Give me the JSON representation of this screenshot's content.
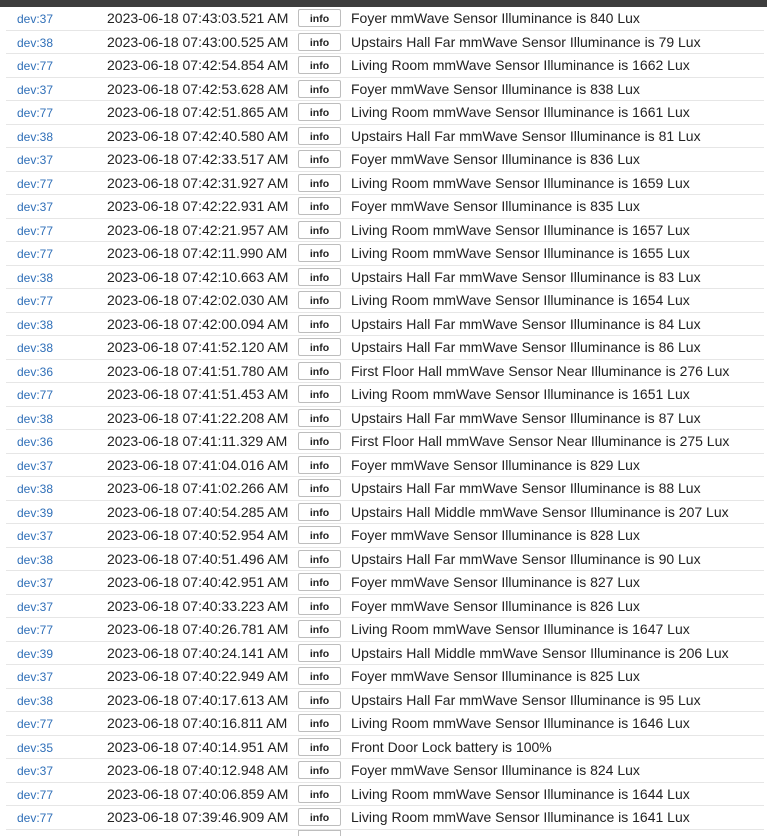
{
  "log": {
    "entries": [
      {
        "device": "dev:37",
        "timestamp": "2023-06-18 07:43:03.521 AM",
        "level": "info",
        "message": "Foyer mmWave Sensor Illuminance is 840 Lux"
      },
      {
        "device": "dev:38",
        "timestamp": "2023-06-18 07:43:00.525 AM",
        "level": "info",
        "message": "Upstairs Hall Far mmWave Sensor Illuminance is 79 Lux"
      },
      {
        "device": "dev:77",
        "timestamp": "2023-06-18 07:42:54.854 AM",
        "level": "info",
        "message": "Living Room mmWave Sensor Illuminance is 1662 Lux"
      },
      {
        "device": "dev:37",
        "timestamp": "2023-06-18 07:42:53.628 AM",
        "level": "info",
        "message": "Foyer mmWave Sensor Illuminance is 838 Lux"
      },
      {
        "device": "dev:77",
        "timestamp": "2023-06-18 07:42:51.865 AM",
        "level": "info",
        "message": "Living Room mmWave Sensor Illuminance is 1661 Lux"
      },
      {
        "device": "dev:38",
        "timestamp": "2023-06-18 07:42:40.580 AM",
        "level": "info",
        "message": "Upstairs Hall Far mmWave Sensor Illuminance is 81 Lux"
      },
      {
        "device": "dev:37",
        "timestamp": "2023-06-18 07:42:33.517 AM",
        "level": "info",
        "message": "Foyer mmWave Sensor Illuminance is 836 Lux"
      },
      {
        "device": "dev:77",
        "timestamp": "2023-06-18 07:42:31.927 AM",
        "level": "info",
        "message": "Living Room mmWave Sensor Illuminance is 1659 Lux"
      },
      {
        "device": "dev:37",
        "timestamp": "2023-06-18 07:42:22.931 AM",
        "level": "info",
        "message": "Foyer mmWave Sensor Illuminance is 835 Lux"
      },
      {
        "device": "dev:77",
        "timestamp": "2023-06-18 07:42:21.957 AM",
        "level": "info",
        "message": "Living Room mmWave Sensor Illuminance is 1657 Lux"
      },
      {
        "device": "dev:77",
        "timestamp": "2023-06-18 07:42:11.990 AM",
        "level": "info",
        "message": "Living Room mmWave Sensor Illuminance is 1655 Lux"
      },
      {
        "device": "dev:38",
        "timestamp": "2023-06-18 07:42:10.663 AM",
        "level": "info",
        "message": "Upstairs Hall Far mmWave Sensor Illuminance is 83 Lux"
      },
      {
        "device": "dev:77",
        "timestamp": "2023-06-18 07:42:02.030 AM",
        "level": "info",
        "message": "Living Room mmWave Sensor Illuminance is 1654 Lux"
      },
      {
        "device": "dev:38",
        "timestamp": "2023-06-18 07:42:00.094 AM",
        "level": "info",
        "message": "Upstairs Hall Far mmWave Sensor Illuminance is 84 Lux"
      },
      {
        "device": "dev:38",
        "timestamp": "2023-06-18 07:41:52.120 AM",
        "level": "info",
        "message": "Upstairs Hall Far mmWave Sensor Illuminance is 86 Lux"
      },
      {
        "device": "dev:36",
        "timestamp": "2023-06-18 07:41:51.780 AM",
        "level": "info",
        "message": "First Floor Hall mmWave Sensor Near Illuminance is 276 Lux"
      },
      {
        "device": "dev:77",
        "timestamp": "2023-06-18 07:41:51.453 AM",
        "level": "info",
        "message": "Living Room mmWave Sensor Illuminance is 1651 Lux"
      },
      {
        "device": "dev:38",
        "timestamp": "2023-06-18 07:41:22.208 AM",
        "level": "info",
        "message": "Upstairs Hall Far mmWave Sensor Illuminance is 87 Lux"
      },
      {
        "device": "dev:36",
        "timestamp": "2023-06-18 07:41:11.329 AM",
        "level": "info",
        "message": "First Floor Hall mmWave Sensor Near Illuminance is 275 Lux"
      },
      {
        "device": "dev:37",
        "timestamp": "2023-06-18 07:41:04.016 AM",
        "level": "info",
        "message": "Foyer mmWave Sensor Illuminance is 829 Lux"
      },
      {
        "device": "dev:38",
        "timestamp": "2023-06-18 07:41:02.266 AM",
        "level": "info",
        "message": "Upstairs Hall Far mmWave Sensor Illuminance is 88 Lux"
      },
      {
        "device": "dev:39",
        "timestamp": "2023-06-18 07:40:54.285 AM",
        "level": "info",
        "message": "Upstairs Hall Middle mmWave Sensor Illuminance is 207 Lux"
      },
      {
        "device": "dev:37",
        "timestamp": "2023-06-18 07:40:52.954 AM",
        "level": "info",
        "message": "Foyer mmWave Sensor Illuminance is 828 Lux"
      },
      {
        "device": "dev:38",
        "timestamp": "2023-06-18 07:40:51.496 AM",
        "level": "info",
        "message": "Upstairs Hall Far mmWave Sensor Illuminance is 90 Lux"
      },
      {
        "device": "dev:37",
        "timestamp": "2023-06-18 07:40:42.951 AM",
        "level": "info",
        "message": "Foyer mmWave Sensor Illuminance is 827 Lux"
      },
      {
        "device": "dev:37",
        "timestamp": "2023-06-18 07:40:33.223 AM",
        "level": "info",
        "message": "Foyer mmWave Sensor Illuminance is 826 Lux"
      },
      {
        "device": "dev:77",
        "timestamp": "2023-06-18 07:40:26.781 AM",
        "level": "info",
        "message": "Living Room mmWave Sensor Illuminance is 1647 Lux"
      },
      {
        "device": "dev:39",
        "timestamp": "2023-06-18 07:40:24.141 AM",
        "level": "info",
        "message": "Upstairs Hall Middle mmWave Sensor Illuminance is 206 Lux"
      },
      {
        "device": "dev:37",
        "timestamp": "2023-06-18 07:40:22.949 AM",
        "level": "info",
        "message": "Foyer mmWave Sensor Illuminance is 825 Lux"
      },
      {
        "device": "dev:38",
        "timestamp": "2023-06-18 07:40:17.613 AM",
        "level": "info",
        "message": "Upstairs Hall Far mmWave Sensor Illuminance is 95 Lux"
      },
      {
        "device": "dev:77",
        "timestamp": "2023-06-18 07:40:16.811 AM",
        "level": "info",
        "message": "Living Room mmWave Sensor Illuminance is 1646 Lux"
      },
      {
        "device": "dev:35",
        "timestamp": "2023-06-18 07:40:14.951 AM",
        "level": "info",
        "message": "Front Door Lock battery is 100%"
      },
      {
        "device": "dev:37",
        "timestamp": "2023-06-18 07:40:12.948 AM",
        "level": "info",
        "message": "Foyer mmWave Sensor Illuminance is 824 Lux"
      },
      {
        "device": "dev:77",
        "timestamp": "2023-06-18 07:40:06.859 AM",
        "level": "info",
        "message": "Living Room mmWave Sensor Illuminance is 1644 Lux"
      },
      {
        "device": "dev:77",
        "timestamp": "2023-06-18 07:39:46.909 AM",
        "level": "info",
        "message": "Living Room mmWave Sensor Illuminance is 1641 Lux"
      }
    ]
  }
}
